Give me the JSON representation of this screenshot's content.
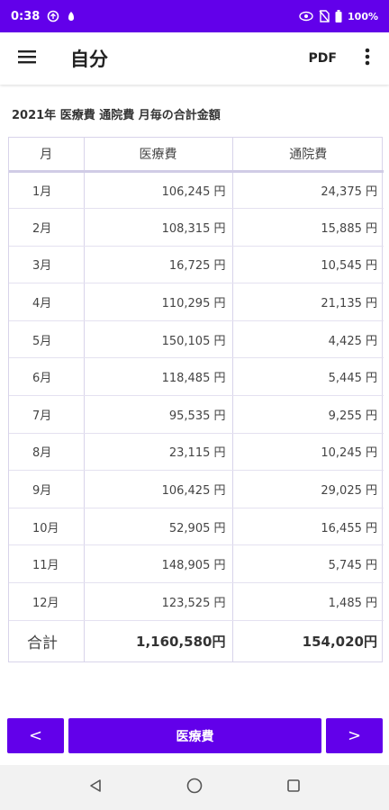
{
  "status_bar": {
    "time": "0:38",
    "battery": "100%"
  },
  "app_bar": {
    "title": "自分",
    "pdf_label": "PDF"
  },
  "heading": "2021年 医療費 通院費 月毎の合計金額",
  "table": {
    "headers": [
      "月",
      "医療費",
      "通院費"
    ],
    "rows": [
      {
        "month": "1月",
        "medical": "106,245 円",
        "visit": "24,375 円"
      },
      {
        "month": "2月",
        "medical": "108,315 円",
        "visit": "15,885 円"
      },
      {
        "month": "3月",
        "medical": "16,725 円",
        "visit": "10,545 円"
      },
      {
        "month": "4月",
        "medical": "110,295 円",
        "visit": "21,135 円"
      },
      {
        "month": "5月",
        "medical": "150,105 円",
        "visit": "4,425 円"
      },
      {
        "month": "6月",
        "medical": "118,485 円",
        "visit": "5,445 円"
      },
      {
        "month": "7月",
        "medical": "95,535 円",
        "visit": "9,255 円"
      },
      {
        "month": "8月",
        "medical": "23,115 円",
        "visit": "10,245 円"
      },
      {
        "month": "9月",
        "medical": "106,425 円",
        "visit": "29,025 円"
      },
      {
        "month": "10月",
        "medical": "52,905 円",
        "visit": "16,455 円"
      },
      {
        "month": "11月",
        "medical": "148,905 円",
        "visit": "5,745 円"
      },
      {
        "month": "12月",
        "medical": "123,525 円",
        "visit": "1,485 円"
      }
    ],
    "total": {
      "label": "合計",
      "medical": "1,160,580円",
      "visit": "154,020円"
    }
  },
  "buttons": {
    "prev": "<",
    "main": "医療費",
    "next": ">"
  },
  "colors": {
    "accent": "#6200ea"
  }
}
